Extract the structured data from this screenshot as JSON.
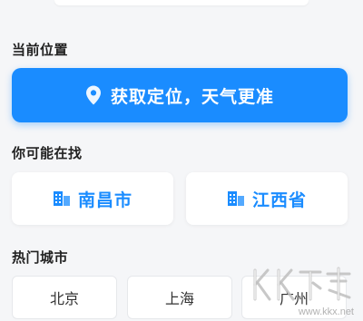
{
  "location": {
    "section_title": "当前位置",
    "get_location_label": "获取定位，天气更准"
  },
  "suggestions": {
    "section_title": "你可能在找",
    "items": [
      {
        "label": "南昌市",
        "icon": "building-icon"
      },
      {
        "label": "江西省",
        "icon": "building-icon"
      }
    ]
  },
  "hot_cities": {
    "section_title": "热门城市",
    "items": [
      {
        "label": "北京"
      },
      {
        "label": "上海"
      },
      {
        "label": "广州"
      }
    ]
  },
  "watermark": {
    "url_text": "www.kkx.net"
  },
  "colors": {
    "accent": "#1a8cff",
    "background": "#f5f6f8",
    "card": "#ffffff"
  }
}
